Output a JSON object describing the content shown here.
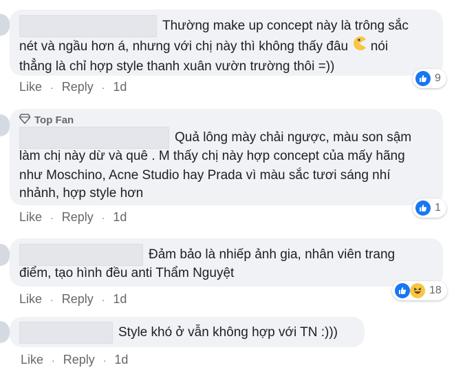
{
  "comments": [
    {
      "top_fan": "",
      "lines": [
        "Thường make up concept này là trông sắc",
        "nét và ngầu hơn á, nhưng với chị này thì không thấy đâu",
        "nói",
        "thẳng là chỉ hợp style thanh xuân vườn trường thôi =))"
      ],
      "like_label": "Like",
      "reply_label": "Reply",
      "time": "1d",
      "reaction_count": "9",
      "reactions": [
        "like-icon"
      ]
    },
    {
      "top_fan": "Top Fan",
      "lines": [
        "Quả lông mày chải ngược, màu son sậm",
        "làm chị này dừ và quê . M thấy chị này hợp concept của mấy hãng",
        "như Moschino, Acne Studio hay Prada vì màu sắc tươi sáng nhí",
        "nhảnh, hợp style hơn"
      ],
      "like_label": "Like",
      "reply_label": "Reply",
      "time": "1d",
      "reaction_count": "1",
      "reactions": [
        "like-icon"
      ]
    },
    {
      "top_fan": "",
      "lines": [
        "Đảm bảo là nhiếp ảnh gia, nhân viên trang",
        "điểm, tạo hình đều anti Thẩm Nguyệt"
      ],
      "like_label": "Like",
      "reply_label": "Reply",
      "time": "1d",
      "reaction_count": "18",
      "reactions": [
        "like-icon",
        "haha-icon"
      ]
    },
    {
      "top_fan": "",
      "lines": [
        "Style khó ở vẫn không hợp với TN :)))"
      ],
      "like_label": "Like",
      "reply_label": "Reply",
      "time": "1d",
      "reaction_count": "",
      "reactions": []
    }
  ],
  "colors": {
    "bubble": "#f0f2f5",
    "meta": "#65676b",
    "like_blue": "#1877f2",
    "haha_yellow": "#f7c744"
  }
}
